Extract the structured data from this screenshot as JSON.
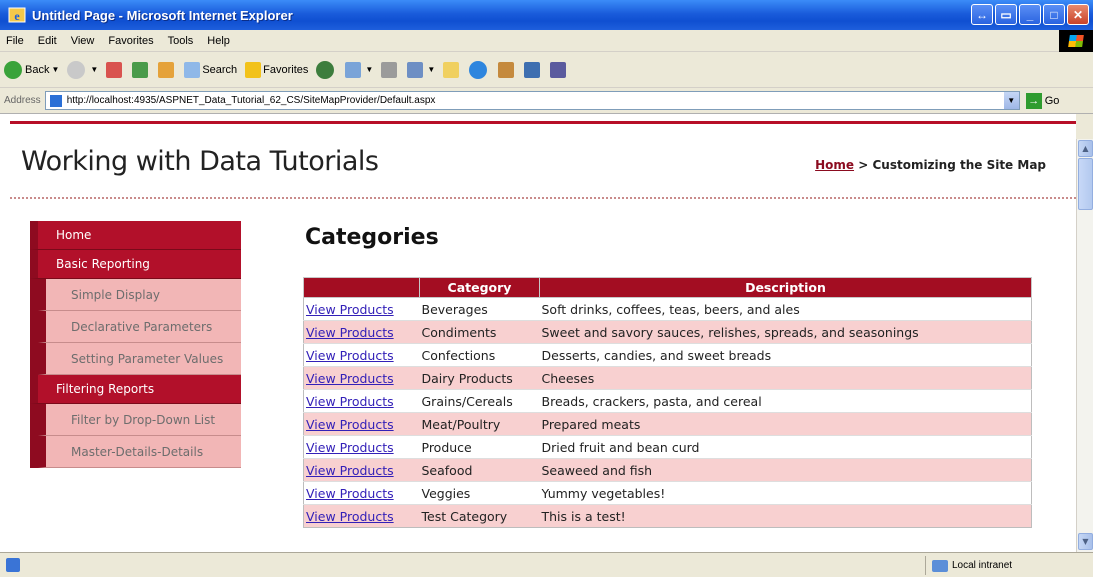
{
  "window": {
    "title": "Untitled Page - Microsoft Internet Explorer",
    "buttons": [
      "minimize",
      "maximize",
      "close"
    ]
  },
  "menu": [
    "File",
    "Edit",
    "View",
    "Favorites",
    "Tools",
    "Help"
  ],
  "toolbar": {
    "back": "Back",
    "search": "Search",
    "favorites": "Favorites"
  },
  "address": {
    "label": "Address",
    "url": "http://localhost:4935/ASPNET_Data_Tutorial_62_CS/SiteMapProvider/Default.aspx",
    "go": "Go"
  },
  "page": {
    "site_title": "Working with Data Tutorials",
    "breadcrumb": {
      "home": "Home",
      "separator": ">",
      "current": "Customizing the Site Map"
    },
    "heading": "Categories"
  },
  "sidebar": {
    "items": [
      {
        "label": "Home",
        "level": 0
      },
      {
        "label": "Basic Reporting",
        "level": 0
      },
      {
        "label": "Simple Display",
        "level": 1
      },
      {
        "label": "Declarative Parameters",
        "level": 1
      },
      {
        "label": "Setting Parameter Values",
        "level": 1
      },
      {
        "label": "Filtering Reports",
        "level": 0
      },
      {
        "label": "Filter by Drop-Down List",
        "level": 1
      },
      {
        "label": "Master-Details-Details",
        "level": 1
      }
    ]
  },
  "grid": {
    "headers": [
      "",
      "Category",
      "Description"
    ],
    "link_text": "View Products",
    "rows": [
      {
        "category": "Beverages",
        "description": "Soft drinks, coffees, teas, beers, and ales"
      },
      {
        "category": "Condiments",
        "description": "Sweet and savory sauces, relishes, spreads, and seasonings"
      },
      {
        "category": "Confections",
        "description": "Desserts, candies, and sweet breads"
      },
      {
        "category": "Dairy Products",
        "description": "Cheeses"
      },
      {
        "category": "Grains/Cereals",
        "description": "Breads, crackers, pasta, and cereal"
      },
      {
        "category": "Meat/Poultry",
        "description": "Prepared meats"
      },
      {
        "category": "Produce",
        "description": "Dried fruit and bean curd"
      },
      {
        "category": "Seafood",
        "description": "Seaweed and fish"
      },
      {
        "category": "Veggies",
        "description": "Yummy vegetables!"
      },
      {
        "category": "Test Category",
        "description": "This is a test!"
      }
    ]
  },
  "status": {
    "zone": "Local intranet"
  },
  "colors": {
    "accent": "#b2102a",
    "header": "#a30d22",
    "alt_row": "#f8d0d0",
    "submenu": "#f2b6b6"
  }
}
